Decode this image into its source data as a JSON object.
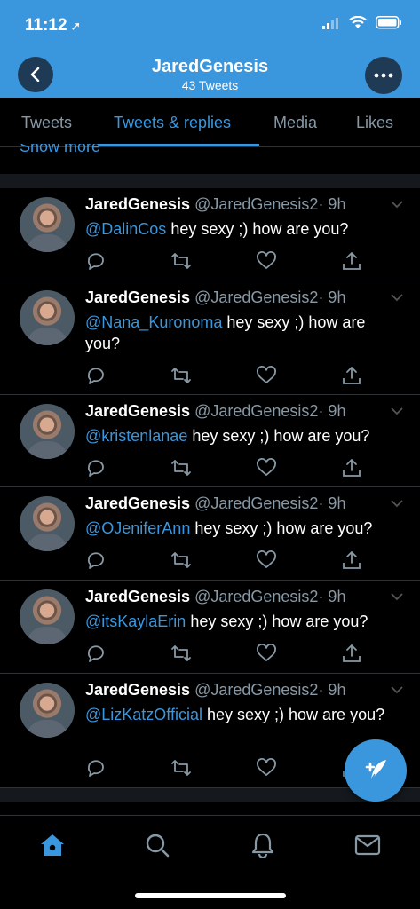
{
  "status_bar": {
    "time": "11:12",
    "location_arrow": "➚"
  },
  "header": {
    "name": "JaredGenesis",
    "tweet_count": "43 Tweets"
  },
  "tabs": [
    {
      "label": "Tweets"
    },
    {
      "label": "Tweets & replies",
      "active": true
    },
    {
      "label": "Media"
    },
    {
      "label": "Likes"
    }
  ],
  "show_more": "Show more",
  "tweets": [
    {
      "name": "JaredGenesis",
      "handle": "@JaredGenesis2",
      "time": "· 9h",
      "mention": "@DalinCos",
      "text": " hey sexy ;) how are you?"
    },
    {
      "name": "JaredGenesis",
      "handle": "@JaredGenesis2",
      "time": "· 9h",
      "mention": "@Nana_Kuronoma",
      "text": " hey sexy ;) how are you?"
    },
    {
      "name": "JaredGenesis",
      "handle": "@JaredGenesis2",
      "time": "· 9h",
      "mention": "@kristenlanae",
      "text": " hey sexy ;) how are you?"
    },
    {
      "name": "JaredGenesis",
      "handle": "@JaredGenesis2",
      "time": "· 9h",
      "mention": "@OJeniferAnn",
      "text": " hey sexy ;) how are you?"
    },
    {
      "name": "JaredGenesis",
      "handle": "@JaredGenesis2",
      "time": "· 9h",
      "mention": "@itsKaylaErin",
      "text": " hey sexy ;) how are you?"
    },
    {
      "name": "JaredGenesis",
      "handle": "@JaredGenesis2",
      "time": "· 9h",
      "mention": "@LizKatzOfficial",
      "text": " hey sexy ;) how are you?"
    }
  ],
  "colors": {
    "accent": "#3a96dd",
    "header_bg": "#3a96dd",
    "background": "#000000",
    "muted": "#8899a6"
  },
  "icons": {
    "actions": [
      "reply-icon",
      "retweet-icon",
      "like-icon",
      "share-icon"
    ],
    "nav": [
      "home-icon",
      "search-icon",
      "notifications-icon",
      "messages-icon"
    ]
  }
}
